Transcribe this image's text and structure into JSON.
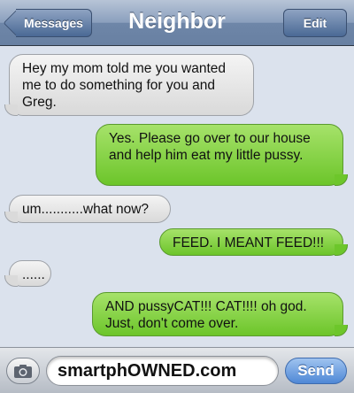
{
  "header": {
    "back_label": "Messages",
    "title": "Neighbor",
    "edit_label": "Edit"
  },
  "messages": [
    {
      "side": "received",
      "text": "Hey my mom told me you wanted me to do something for you and Greg."
    },
    {
      "side": "sent",
      "text": "Yes. Please go over to our house and help him eat my little pussy."
    },
    {
      "side": "received",
      "text": "um...........what now?"
    },
    {
      "side": "sent",
      "text": "FEED. I MEANT FEED!!!"
    },
    {
      "side": "received",
      "text": "......"
    },
    {
      "side": "sent",
      "text": "AND pussyCAT!!! CAT!!!! oh god. Just, don't come over."
    }
  ],
  "composer": {
    "field_value": "smartphOWNED.com",
    "send_label": "Send",
    "camera_icon": "camera-icon"
  },
  "colors": {
    "sent_bubble": "#7ccf3a",
    "received_bubble": "#e6e6e6",
    "nav_bar": "#7f95b6",
    "send_button": "#5b93dc"
  }
}
